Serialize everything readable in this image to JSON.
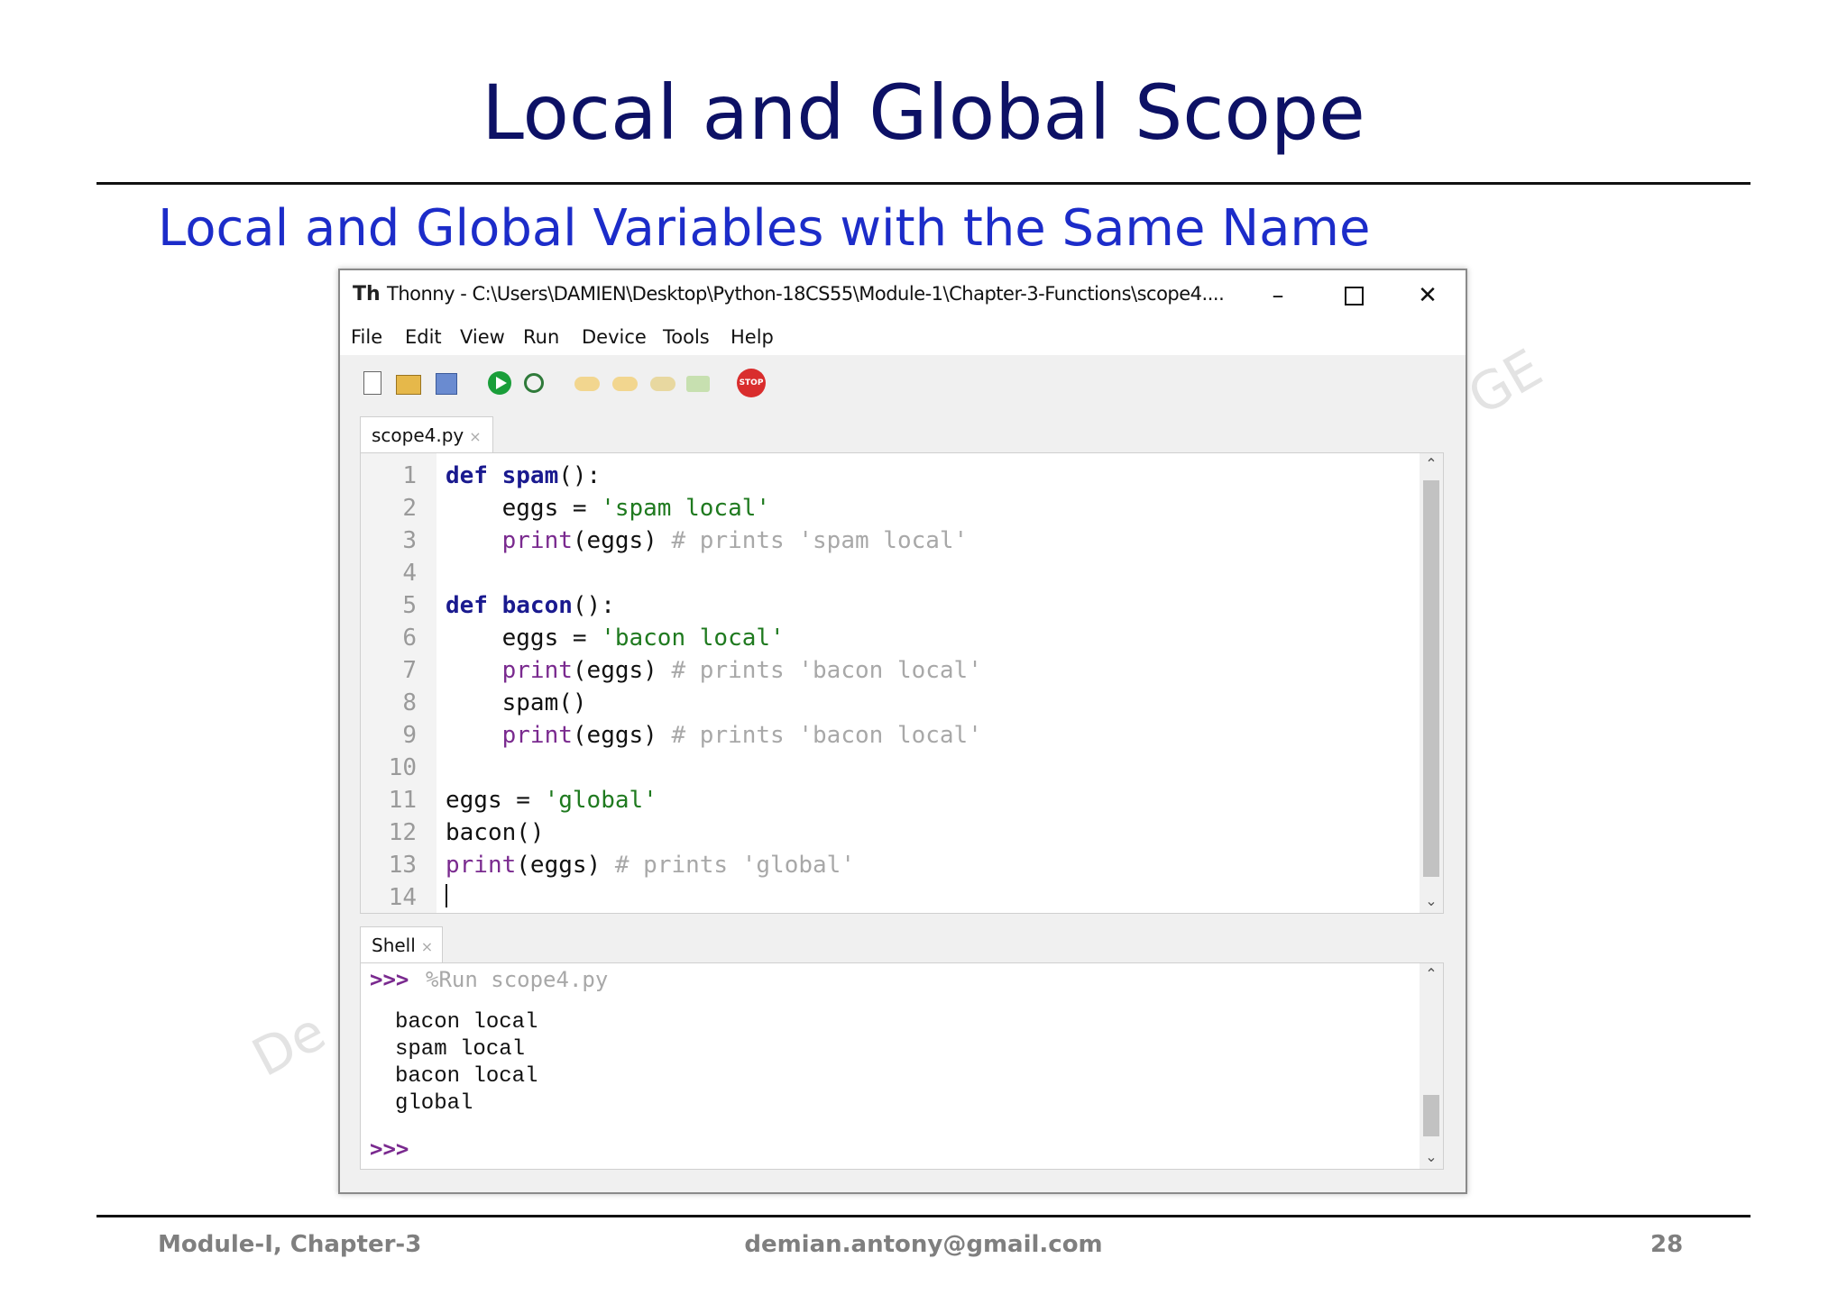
{
  "slide": {
    "title": "Local and Global Scope",
    "subtitle": "Local and Global Variables with the Same Name",
    "watermark_right": "GE",
    "watermark_left": "De"
  },
  "window": {
    "title": "Thonny  -  C:\\Users\\DAMIEN\\Desktop\\Python-18CS55\\Module-1\\Chapter-3-Functions\\scope4....",
    "app_icon": "Th",
    "min_label": "–",
    "close_label": "✕",
    "menu": [
      "File",
      "Edit",
      "View",
      "Run",
      "Device",
      "Tools",
      "Help"
    ],
    "toolbar_icons": [
      "new-file-icon",
      "open-file-icon",
      "save-icon",
      "run-icon",
      "debug-icon",
      "step-over-icon",
      "step-into-icon",
      "step-out-icon",
      "resume-icon",
      "stop-icon"
    ],
    "stop_label": "STOP"
  },
  "editor": {
    "tab_label": "scope4.py",
    "tab_close": "×",
    "line_numbers": [
      "1",
      "2",
      "3",
      "4",
      "5",
      "6",
      "7",
      "8",
      "9",
      "10",
      "11",
      "12",
      "13",
      "14"
    ],
    "lines": [
      "def spam():",
      "    eggs = 'spam local'",
      "    print(eggs) # prints 'spam local'",
      "",
      "def bacon():",
      "    eggs = 'bacon local'",
      "    print(eggs) # prints 'bacon local'",
      "    spam()",
      "    print(eggs) # prints 'bacon local'",
      "",
      "eggs = 'global'",
      "bacon()",
      "print(eggs) # prints 'global'"
    ]
  },
  "shell": {
    "tab_label": "Shell",
    "tab_close": "×",
    "prompt": ">>>",
    "run_command": "%Run scope4.py",
    "output": [
      "bacon local",
      "spam local",
      "bacon local",
      "global"
    ]
  },
  "footer": {
    "left": "Module-I, Chapter-3",
    "center": "demian.antony@gmail.com",
    "page": "28"
  }
}
